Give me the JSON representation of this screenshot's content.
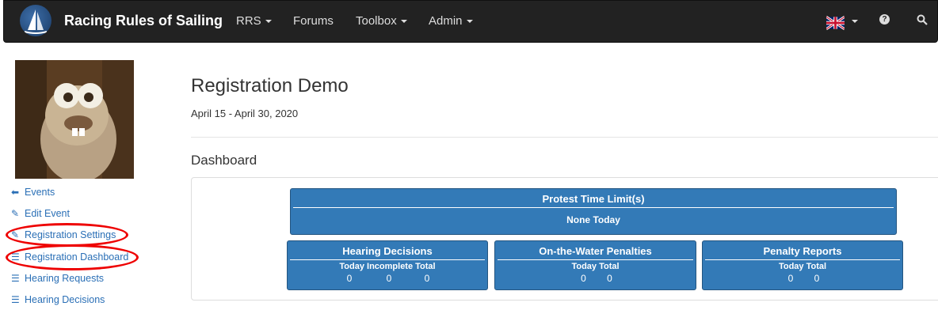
{
  "navbar": {
    "brand": "Racing Rules of Sailing",
    "items": [
      {
        "label": "RRS",
        "dropdown": true
      },
      {
        "label": "Forums",
        "dropdown": false
      },
      {
        "label": "Toolbox",
        "dropdown": true
      },
      {
        "label": "Admin",
        "dropdown": true
      }
    ],
    "right_icons": [
      "uk-flag-icon",
      "help-icon",
      "search-icon"
    ]
  },
  "sidebar": {
    "avatar": "squirrel-avatar",
    "links": [
      {
        "label": "Events",
        "icon": "arrow-left-icon"
      },
      {
        "label": "Edit Event",
        "icon": "pencil-icon"
      },
      {
        "label": "Registration Settings",
        "icon": "pencil-icon",
        "highlighted": true
      },
      {
        "label": "Registration Dashboard",
        "icon": "list-icon",
        "highlighted": true
      },
      {
        "label": "Hearing Requests",
        "icon": "list-icon"
      },
      {
        "label": "Hearing Decisions",
        "icon": "list-icon"
      }
    ]
  },
  "main": {
    "title": "Registration Demo",
    "dates": "April 15 - April 30, 2020",
    "section": "Dashboard",
    "protest": {
      "title": "Protest Time Limit(s)",
      "value": "None Today"
    },
    "tiles": [
      {
        "title": "Hearing Decisions",
        "subheader": "Today Incomplete Total",
        "values": [
          "0",
          "0",
          "0"
        ]
      },
      {
        "title": "On-the-Water Penalties",
        "subheader": "Today Total",
        "values": [
          "0",
          "0"
        ]
      },
      {
        "title": "Penalty Reports",
        "subheader": "Today Total",
        "values": [
          "0",
          "0"
        ]
      }
    ]
  },
  "colors": {
    "navbar": "#222222",
    "tile": "#337ab7",
    "link": "#2a6fb6",
    "highlight": "#e00000"
  }
}
